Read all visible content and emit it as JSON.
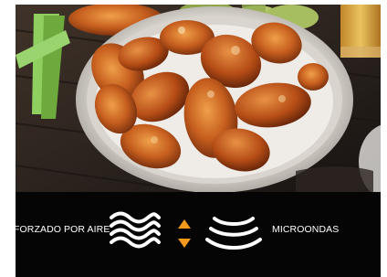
{
  "image": {
    "subject": "food-photo-icon"
  },
  "comparison": {
    "left_label": "FORZADO POR AIRE",
    "right_label": "MICROONDAS",
    "left_icon": "wavy-air-icon",
    "center_icon": "up-down-arrows-icon",
    "right_icon": "microwave-waves-icon"
  },
  "colors": {
    "background": "#050505",
    "text": "#ffffff",
    "accent": "#f39a1c"
  }
}
